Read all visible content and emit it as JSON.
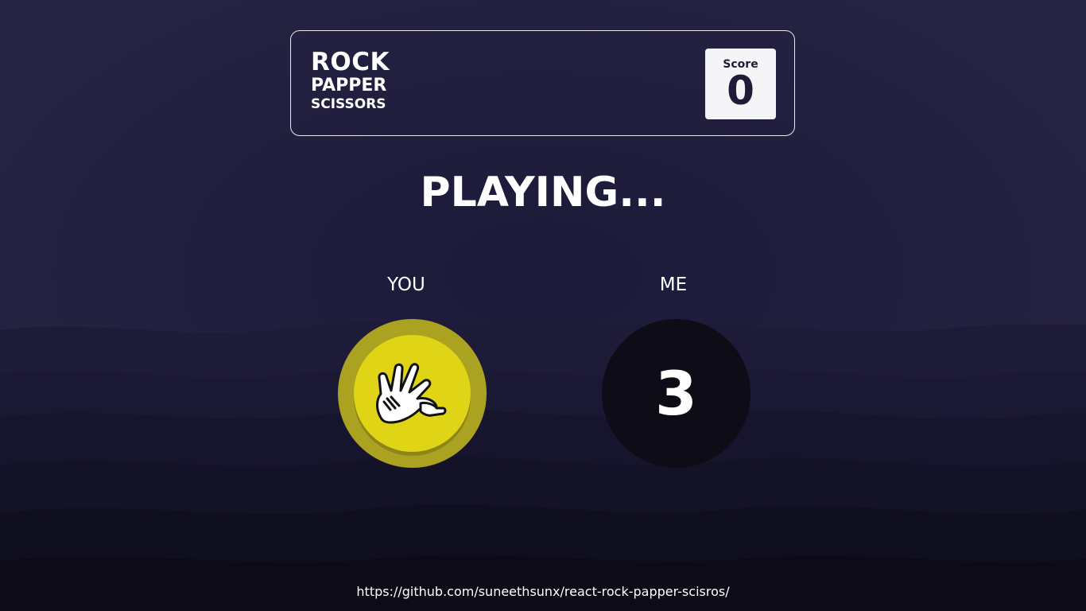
{
  "header": {
    "title_line1": "ROCK",
    "title_line2": "PAPPER",
    "title_line3": "SCISSORS",
    "score_label": "Score",
    "score_value": "0"
  },
  "status": "PLAYING...",
  "players": {
    "you_label": "YOU",
    "me_label": "ME"
  },
  "player_choice": {
    "icon": "paper-hand-icon",
    "ring_color": "#aba222",
    "fill_color": "#e0d416"
  },
  "opponent": {
    "countdown": "3",
    "circle_color": "#0e0c17"
  },
  "footer": {
    "link": "https://github.com/suneethsunx/react-rock-papper-scisros/"
  },
  "colors": {
    "background": "#221f40",
    "text": "#ffffff"
  }
}
